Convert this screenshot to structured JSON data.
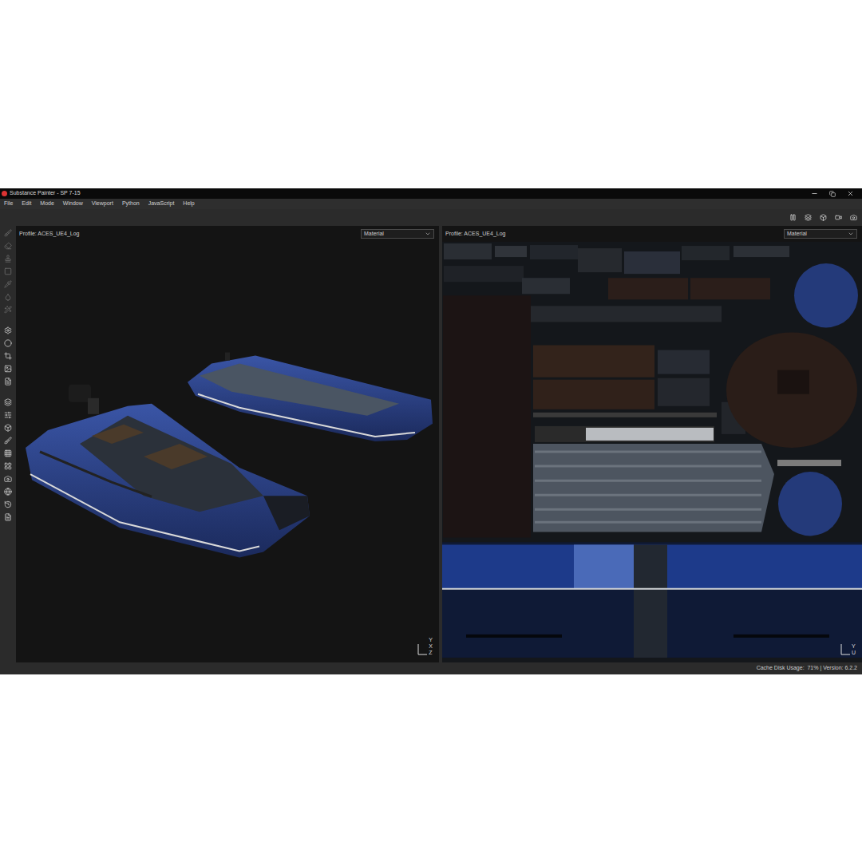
{
  "window": {
    "title": "Substance Painter - SP 7-15"
  },
  "menu": [
    "File",
    "Edit",
    "Mode",
    "Window",
    "Viewport",
    "Python",
    "JavaScript",
    "Help"
  ],
  "viewports": [
    {
      "name": "3d-viewport",
      "profile": "Profile: ACES_UE4_Log",
      "channel": "Material",
      "axes": [
        "Y",
        "X",
        "Z"
      ]
    },
    {
      "name": "uv-viewport",
      "profile": "Profile: ACES_UE4_Log",
      "channel": "Material",
      "axes": [
        "Y",
        "U"
      ]
    }
  ],
  "status_bar": {
    "text": "Cache Disk Usage:  71% | Version: 6.2.2"
  }
}
